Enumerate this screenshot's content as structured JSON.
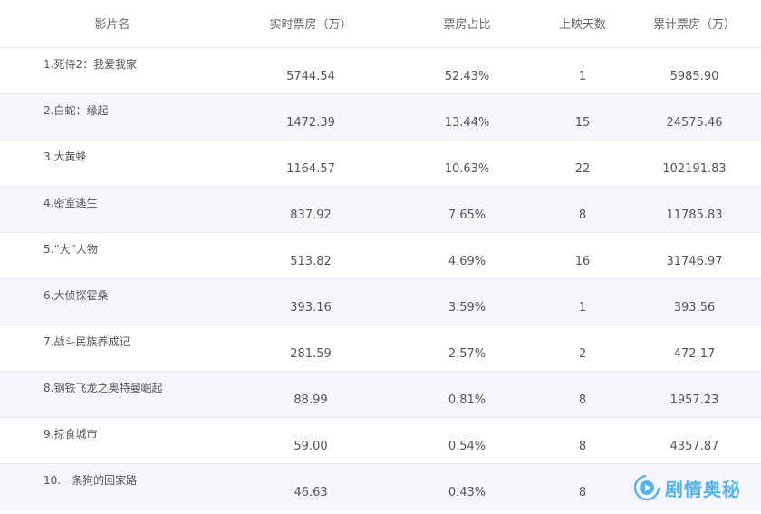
{
  "table": {
    "headers": [
      "影片名",
      "实时票房（万）",
      "票房占比",
      "上映天数",
      "累计票房（万）"
    ],
    "rows": [
      {
        "name": "1.死侍2：我爱我家",
        "realtime": "5744.54",
        "share": "52.43%",
        "days": "1",
        "total": "5985.90"
      },
      {
        "name": "2.白蛇：缘起",
        "realtime": "1472.39",
        "share": "13.44%",
        "days": "15",
        "total": "24575.46"
      },
      {
        "name": "3.大黄蜂",
        "realtime": "1164.57",
        "share": "10.63%",
        "days": "22",
        "total": "102191.83"
      },
      {
        "name": "4.密室逃生",
        "realtime": "837.92",
        "share": "7.65%",
        "days": "8",
        "total": "11785.83"
      },
      {
        "name": "5.“大”人物",
        "realtime": "513.82",
        "share": "4.69%",
        "days": "16",
        "total": "31746.97"
      },
      {
        "name": "6.大侦探霍桑",
        "realtime": "393.16",
        "share": "3.59%",
        "days": "1",
        "total": "393.56"
      },
      {
        "name": "7.战斗民族养成记",
        "realtime": "281.59",
        "share": "2.57%",
        "days": "2",
        "total": "472.17"
      },
      {
        "name": "8.钢铁飞龙之奥特曼崛起",
        "realtime": "88.99",
        "share": "0.81%",
        "days": "8",
        "total": "1957.23"
      },
      {
        "name": "9.掠食城市",
        "realtime": "59.00",
        "share": "0.54%",
        "days": "8",
        "total": "4357.87"
      },
      {
        "name": "10.一条狗的回家路",
        "realtime": "46.63",
        "share": "0.43%",
        "days": "8",
        "total": ""
      }
    ]
  },
  "watermark": {
    "text": "剧情奥秘",
    "icon": "play-swirl-logo-icon",
    "color": "#3fa9e6"
  }
}
